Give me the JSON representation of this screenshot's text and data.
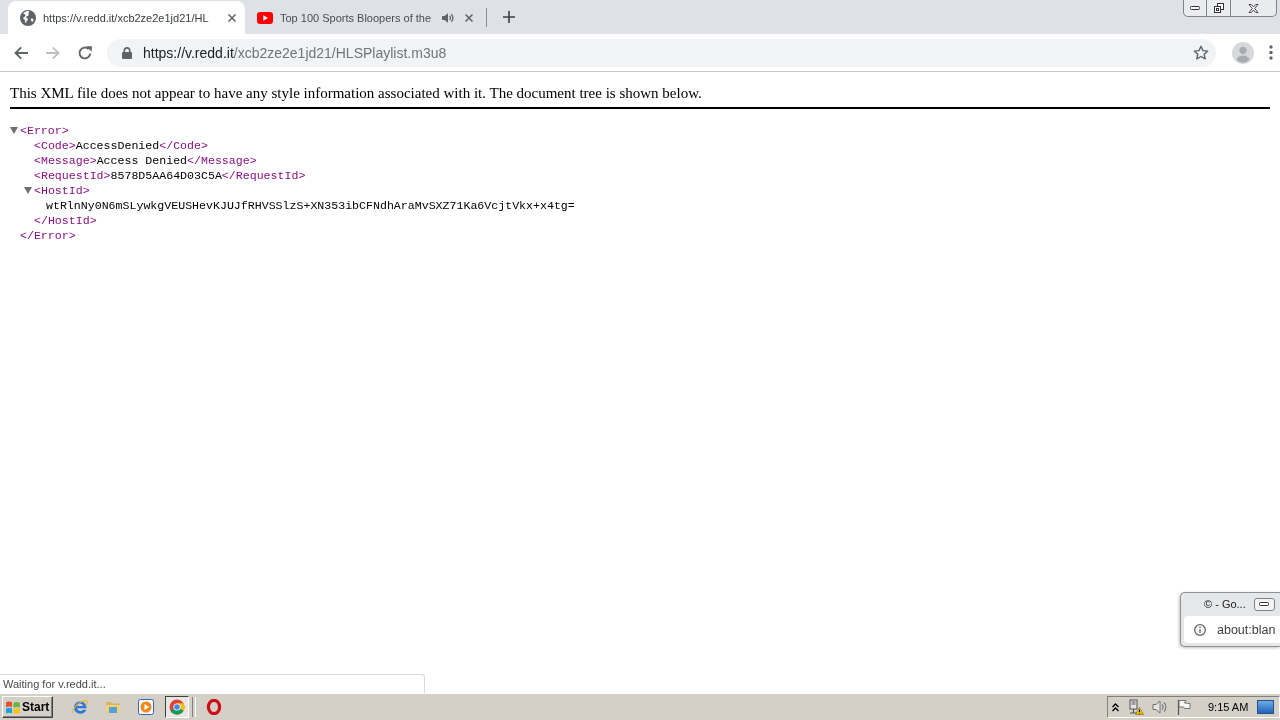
{
  "tabs": [
    {
      "title": "https://v.redd.it/xcb2ze2e1jd21/HL",
      "selected": true,
      "audible": false
    },
    {
      "title": "Top 100 Sports Bloopers of the",
      "selected": false,
      "audible": true
    }
  ],
  "toolbar": {
    "nav_buttons": [
      {
        "kind": "back",
        "disabled": false
      },
      {
        "kind": "forward",
        "disabled": true
      },
      {
        "kind": "reload",
        "disabled": false
      }
    ],
    "address": {
      "origin": "https://v.redd.it",
      "path": "/xcb2ze2e1jd21/HLSPlaylist.m3u8"
    },
    "bookmarked": false
  },
  "page": {
    "notice": "This XML file does not appear to have any style information associated with it. The document tree is shown below.",
    "tree": {
      "kind": "element",
      "expanded": true,
      "open_tag": "<Error>",
      "close_tag": "</Error>",
      "children": [
        {
          "kind": "leaf",
          "open_tag": "<Code>",
          "text": "AccessDenied",
          "close_tag": "</Code>"
        },
        {
          "kind": "leaf",
          "open_tag": "<Message>",
          "text": "Access Denied",
          "close_tag": "</Message>"
        },
        {
          "kind": "leaf",
          "open_tag": "<RequestId>",
          "text": "8578D5AA64D03C5A",
          "close_tag": "</RequestId>"
        },
        {
          "kind": "element",
          "expanded": true,
          "open_tag": "<HostId>",
          "close_tag": "</HostId>",
          "children": [
            {
              "kind": "text",
              "text": "wtRlnNy0N6mSLywkgVEUSHevKJUJfRHVSSlzS+XN353ibCFNdhAraMvSXZ71Ka6VcjtVkx+x4tg="
            }
          ]
        }
      ]
    }
  },
  "status_bubble": "Waiting for v.redd.it...",
  "popup_window": {
    "title": "© - Go...",
    "address": "about:blan"
  },
  "taskbar": {
    "start_label": "Start",
    "apps": [
      {
        "selected": false
      },
      {
        "selected": false
      },
      {
        "selected": false
      },
      {
        "selected": true
      },
      {
        "selected": false
      }
    ],
    "clock": "9:15 AM"
  }
}
